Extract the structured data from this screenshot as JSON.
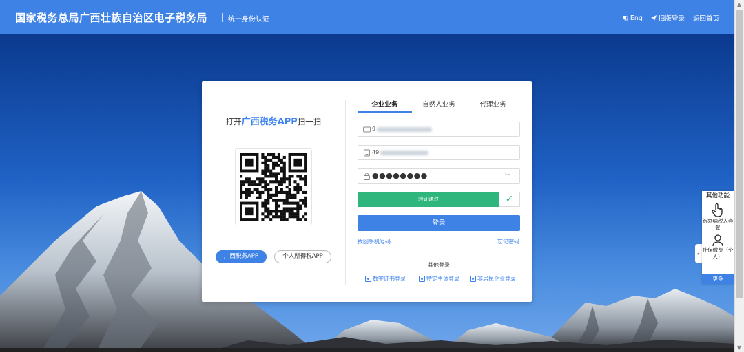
{
  "header": {
    "title": "国家税务总局广西壮族自治区电子税务局",
    "subtitle": "统一身份认证",
    "links": [
      {
        "label": "Eng",
        "icon": "translate-icon"
      },
      {
        "label": "旧版登录",
        "icon": "send-icon"
      },
      {
        "label": "返回首页",
        "icon": ""
      }
    ]
  },
  "scan": {
    "prefix": "打开",
    "highlight": "广西税务APP",
    "suffix": "扫一扫"
  },
  "apps": {
    "primary": "广西税务APP",
    "secondary": "个人所得税APP"
  },
  "tabs": [
    "企业业务",
    "自然人业务",
    "代理业务"
  ],
  "active_tab": 0,
  "form": {
    "credit_code_prefix": "9",
    "account_prefix": "49",
    "password_mask": "●●●●●●●●",
    "verify_text": "验证通过",
    "login_label": "登录",
    "find_phone": "找回手机号码",
    "forgot_password": "忘记密码"
  },
  "other_login": {
    "label": "其他登录",
    "options": [
      "数字证书登录",
      "特定主体登录",
      "非居民企业登录"
    ]
  },
  "side_panel": {
    "title": "其他功能",
    "items": [
      "新办纳税人套餐",
      "社保缴费（个人）"
    ],
    "more": "更多"
  },
  "colors": {
    "header_blue": "#3f82e6",
    "verify_green": "#2fb67d",
    "link_blue": "#3c82f0"
  }
}
